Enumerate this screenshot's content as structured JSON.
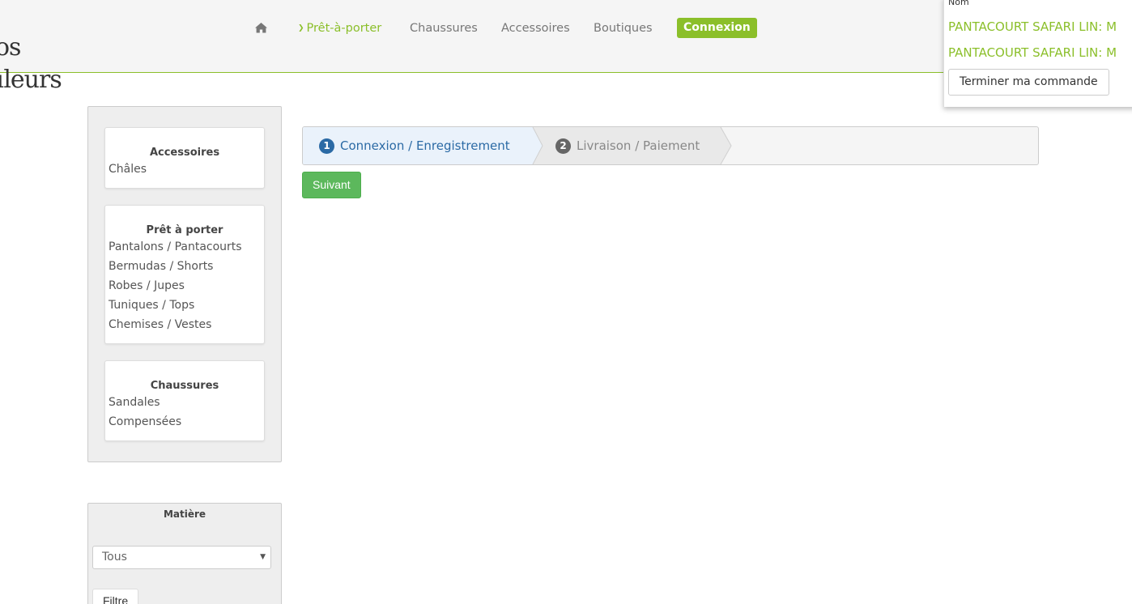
{
  "logo": {
    "line1": "os",
    "line2": "uleurs"
  },
  "nav": {
    "home_icon": "home-icon",
    "pret_chevron": "chevron-down-icon",
    "pret_label": "Prêt-à-porter",
    "chaussures_label": "Chaussures",
    "accessoires_label": "Accessoires",
    "boutiques_label": "Boutiques",
    "connexion_label": "Connexion"
  },
  "cart": {
    "header": "Nom",
    "items": [
      "PANTACOURT SAFARI LIN: M",
      "PANTACOURT SAFARI LIN: M"
    ],
    "checkout_label": "Terminer ma commande"
  },
  "sidebar": {
    "categories": [
      {
        "title": "Accessoires",
        "links": [
          "Châles"
        ]
      },
      {
        "title": "Prêt à porter",
        "links": [
          "Pantalons / Pantacourts",
          "Bermudas / Shorts",
          "Robes / Jupes",
          "Tuniques / Tops",
          "Chemises / Vestes"
        ]
      },
      {
        "title": "Chaussures",
        "links": [
          "Sandales",
          "Compensées"
        ]
      }
    ]
  },
  "filter": {
    "title": "Matière",
    "select_value": "Tous",
    "button_label": "Filtre"
  },
  "steps": [
    {
      "num": "1",
      "label": "Connexion / Enregistrement",
      "active": true
    },
    {
      "num": "2",
      "label": "Livraison / Paiement",
      "active": false
    }
  ],
  "next_button": "Suivant",
  "colors": {
    "brand_green": "#8bbf2a",
    "active_step_blue": "#2b6aa5",
    "success_green": "#5cb85c"
  }
}
